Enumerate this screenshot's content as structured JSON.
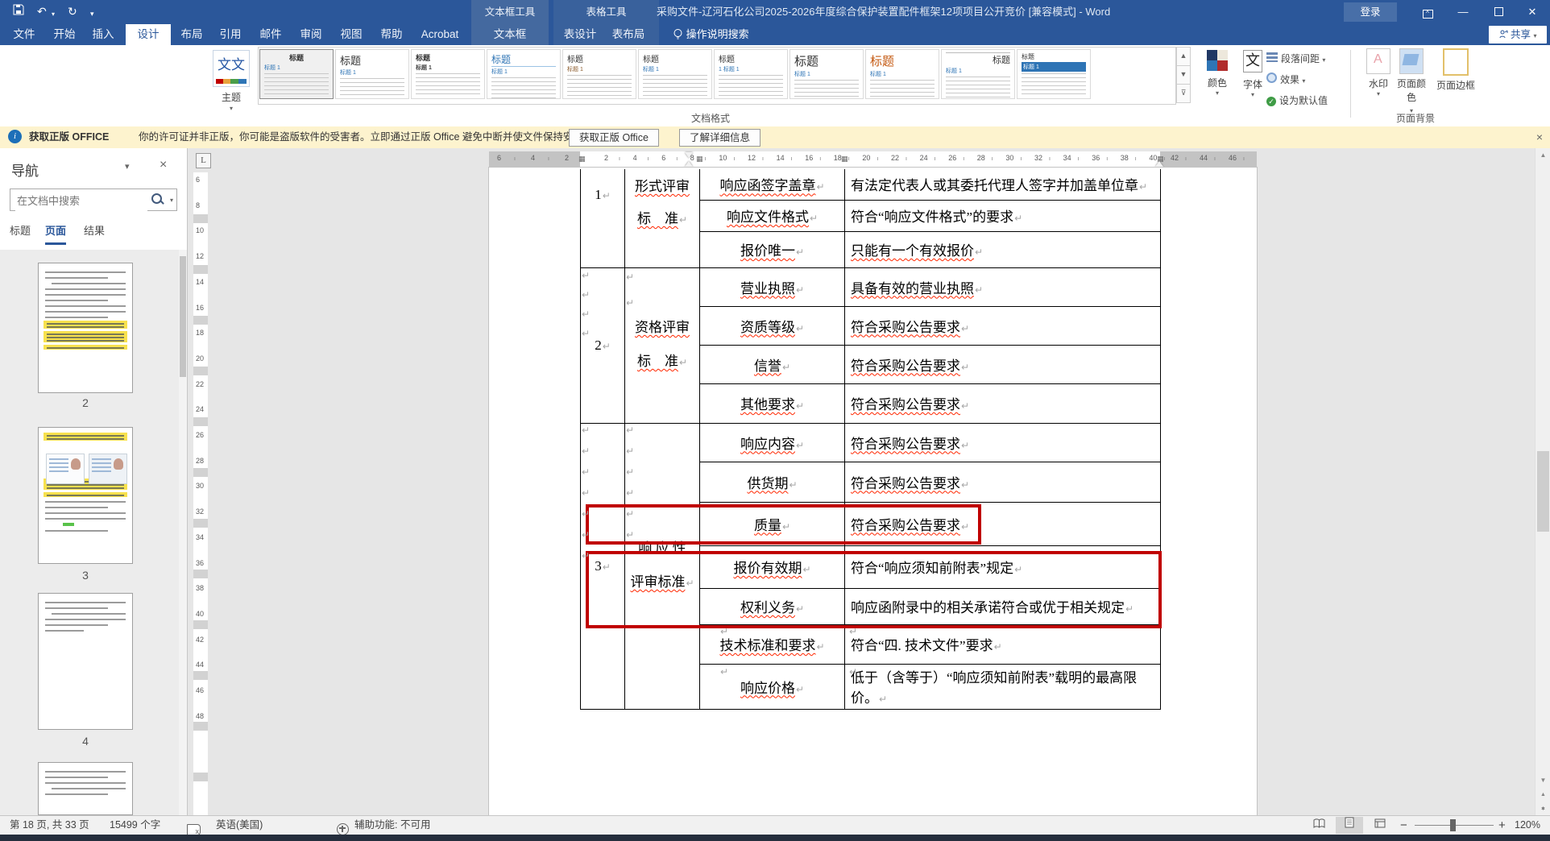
{
  "titlebar": {
    "title": "采购文件-辽河石化公司2025-2026年度综合保护装置配件框架12项项目公开竞价 [兼容模式] - Word",
    "ctx_group1": "文本框工具",
    "ctx_group2": "表格工具",
    "signin": "登录"
  },
  "tabs": {
    "items": [
      "文件",
      "开始",
      "插入",
      "设计",
      "布局",
      "引用",
      "邮件",
      "审阅",
      "视图",
      "帮助",
      "Acrobat"
    ],
    "ctx1": "文本框",
    "ctx2a": "表设计",
    "ctx2b": "表布局",
    "tellme": "操作说明搜索",
    "share": "共享"
  },
  "ribbon": {
    "themes": "主题",
    "gallery": [
      {
        "title": "标题",
        "sub": "标题 1",
        "variant": "gv1",
        "selected": true
      },
      {
        "title": "标题",
        "sub": "标题 1",
        "variant": "gv2",
        "selected": false
      },
      {
        "title": "标题",
        "sub": "标题 1",
        "variant": "gv3",
        "selected": false
      },
      {
        "title": "标题",
        "sub": "标题 1",
        "variant": "gv4",
        "selected": false
      },
      {
        "title": "标题",
        "sub": "标题 1",
        "variant": "gv5",
        "selected": false
      },
      {
        "title": "标题",
        "sub": "标题 1",
        "variant": "gv6",
        "selected": false
      },
      {
        "title": "标题",
        "sub": "1 标题 1",
        "variant": "gv7",
        "selected": false
      },
      {
        "title": "标题",
        "sub": "标题 1",
        "variant": "gv8",
        "selected": false
      },
      {
        "title": "标题",
        "sub": "标题 1",
        "variant": "gv9",
        "selected": false
      },
      {
        "title": "标题",
        "sub": "标题 1",
        "variant": "gv10",
        "selected": false
      },
      {
        "title": "标题",
        "sub": "标题 1",
        "variant": "gv11",
        "selected": false
      }
    ],
    "colors": "颜色",
    "fonts": "字体",
    "para_spacing": "段落间距",
    "effects": "效果",
    "set_default": "设为默认值",
    "watermark": "水印",
    "page_color": "页面颜色",
    "page_border": "页面边框",
    "group_style": "文档格式",
    "group_bg": "页面背景",
    "accent": "#2b579a"
  },
  "warnbar": {
    "bold": "获取正版 OFFICE",
    "text": "你的许可证并非正版，你可能是盗版软件的受害者。立即通过正版 Office 避免中断并使文件保持安全。",
    "btn1": "获取正版 Office",
    "btn2": "了解详细信息"
  },
  "nav": {
    "title": "导航",
    "search_placeholder": "在文档中搜索",
    "tabs": [
      "标题",
      "页面",
      "结果"
    ],
    "active_tab": "页面",
    "thumbnails": [
      {
        "label": "2"
      },
      {
        "label": "3"
      },
      {
        "label": "4"
      },
      {
        "label": ""
      }
    ]
  },
  "doc": {
    "marks": {
      "pilcrow": "↵"
    }
  },
  "table": {
    "sections": [
      {
        "num": "1",
        "line1": "形式评审",
        "line2": "标　准"
      },
      {
        "num": "2",
        "line1": "资格评审",
        "line2": "标　准"
      },
      {
        "num": "3",
        "line1": "响 应 性",
        "line2": "评审标准"
      }
    ],
    "rows": [
      {
        "item": "响应函签字盖章",
        "req": "有法定代表人或其委托代理人签字并加盖单位章",
        "isq": true,
        "rsq": false
      },
      {
        "item": "响应文件格式",
        "req": "符合“响应文件格式”的要求",
        "isq": true,
        "rsq": false
      },
      {
        "item": "报价唯一",
        "req": "只能有一个有效报价",
        "isq": true,
        "rsq": true
      },
      {
        "item": "营业执照",
        "req": "具备有效的营业执照",
        "isq": true,
        "rsq": true
      },
      {
        "item": "资质等级",
        "req": "符合采购公告要求",
        "isq": true,
        "rsq": true
      },
      {
        "item": "信誉",
        "req": "符合采购公告要求",
        "isq": true,
        "rsq": true
      },
      {
        "item": "其他要求",
        "req": "符合采购公告要求",
        "isq": true,
        "rsq": true
      },
      {
        "item": "响应内容",
        "req": "符合采购公告要求",
        "isq": true,
        "rsq": true
      },
      {
        "item": "供货期",
        "req": "符合采购公告要求",
        "isq": true,
        "rsq": true
      },
      {
        "item": "质量",
        "req": "符合采购公告要求",
        "isq": true,
        "rsq": true
      },
      {
        "item": "报价有效期",
        "req": "符合“响应须知前附表”规定",
        "isq": true,
        "rsq": false
      },
      {
        "item": "权利义务",
        "req": "响应函附录中的相关承诺符合或优于相关规定",
        "isq": true,
        "rsq": false
      },
      {
        "item": "技术标准和要求",
        "req": "符合“四. 技术文件”要求",
        "isq": true,
        "rsq": false
      },
      {
        "item": "响应价格",
        "req": "低于（含等于）“响应须知前附表”载明的最高限价。",
        "isq": true,
        "rsq": false
      }
    ]
  },
  "rulers": {
    "h_left": [
      "6",
      "4",
      "2"
    ],
    "h_white": [
      "2",
      "4",
      "6",
      "8",
      "10",
      "12",
      "14",
      "16",
      "18",
      "20",
      "22",
      "24",
      "26",
      "28",
      "30",
      "32",
      "34",
      "36",
      "38",
      "40"
    ],
    "h_right": [
      "42",
      "44",
      "46"
    ],
    "v": [
      "6",
      "8",
      "10",
      "12",
      "14",
      "16",
      "18",
      "20",
      "22",
      "24",
      "26",
      "28",
      "30",
      "32",
      "34",
      "36",
      "38",
      "40",
      "42",
      "44",
      "46",
      "48"
    ]
  },
  "status": {
    "page": "第 18 页, 共 33 页",
    "words": "15499 个字",
    "lang": "英语(美国)",
    "a11y": "辅助功能: 不可用",
    "zoom": "120%"
  }
}
